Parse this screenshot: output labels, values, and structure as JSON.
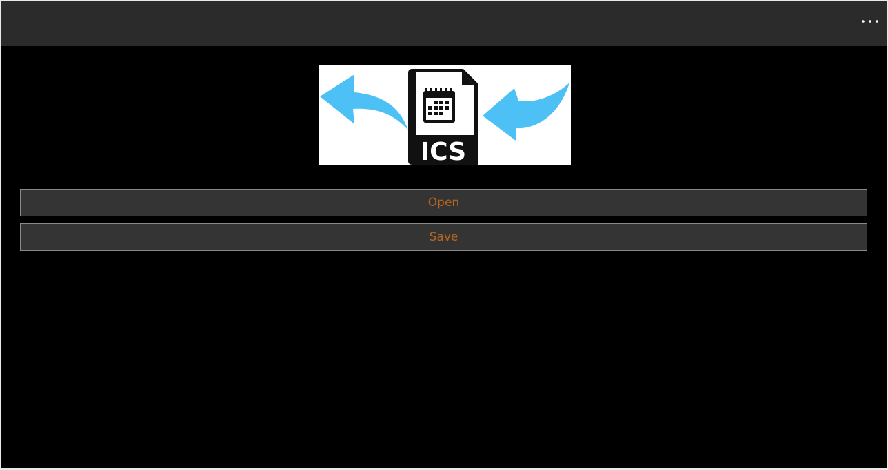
{
  "app_bar": {
    "more_icon": "more-horizontal-icon"
  },
  "logo": {
    "text": "ICS",
    "icons": [
      "arrow-curved-left-icon",
      "calendar-file-icon",
      "arrow-curved-in-icon"
    ],
    "colors": {
      "arrow": "#4dc1f5",
      "document": "#111111",
      "background": "#ffffff"
    }
  },
  "buttons": {
    "open_label": "Open",
    "save_label": "Save"
  },
  "colors": {
    "appbar": "#2b2b2b",
    "background": "#000000",
    "button_background": "#343434",
    "button_border": "#8a8a8a",
    "accent_text": "#b5661f"
  }
}
